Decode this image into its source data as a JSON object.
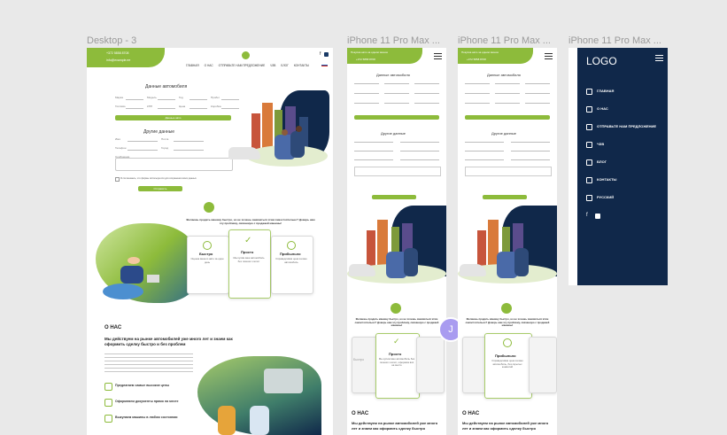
{
  "frames": {
    "desktop": "Desktop - 3",
    "phone1": "iPhone 11 Pro Max ...",
    "phone2": "iPhone 11 Pro Max ...",
    "phone3": "iPhone 11 Pro Max ..."
  },
  "desktop": {
    "phone": "+372 5858 8708",
    "email": "info@example.ee",
    "nav": [
      "ГЛАВНАЯ",
      "О НАС",
      "ОТПРАВЬТЕ НАМ ПРЕДЛОЖЕНИЕ",
      "ЧЗВ",
      "БЛОГ",
      "КОНТАКТЫ"
    ],
    "car_heading": "Данные автомобиля",
    "car_fields": [
      "Марка",
      "Модель",
      "Год",
      "Пробег",
      "Топливо",
      "КПП",
      "Цена",
      "Коробка"
    ],
    "car_btn": "Данные авто",
    "other_heading": "Другие данные",
    "other_fields": [
      "Имя",
      "Почта",
      "Телефон",
      "Город"
    ],
    "comment": "Сообщение",
    "consent": "Я соглашаюсь, что формы используются для сохранения моих данных",
    "submit": "Отправить",
    "question": "Желаешь продать машину быстро, но не хочешь заниматься этим самостоятельно? Доверь нам эту проблему, связанную с продажей машины!",
    "features": [
      {
        "title": "Быстро",
        "text": "Оценка вашего авто за один день"
      },
      {
        "title": "Просто",
        "text": "Мы купим ваш автомобиль без лишних хлопот"
      },
      {
        "title": "Прибыльно",
        "text": "Справедливая цена за ваш автомобиль"
      }
    ],
    "about_title": "О НАС",
    "about_lead": "Мы действуем на рынке автомобилей уже много лет и знаем как оформить сделку быстро и без проблем",
    "bullets": [
      "Предлагаем самые высокие цены",
      "Оформляем документы прямо на месте",
      "Выкупаем машины в любом состоянии"
    ]
  },
  "phone": {
    "banner": "Покупка авто за одним звонок",
    "phone": "+372 5858 8708",
    "car_heading": "Данные автомобиля",
    "other_heading": "Другие данные",
    "question": "Желаешь продать машину быстро, но не хочешь заниматься этим самостоятельно? Доверь нам эту проблему, связанную с продажей машины!",
    "card_simple": {
      "title": "Просто",
      "text": "Мы купим ваш автомобиль без лишних хлопот, оформим всё на месте"
    },
    "card_profit": {
      "title": "Прибыльно",
      "text": "Справедливая цена за ваш автомобиль, без скрытых комиссий"
    },
    "side_left": "Быстро",
    "about_title": "О НАС",
    "about_lead": "Мы действуем на рынке автомобилей уже много лет и знаем как оформить сделку быстро"
  },
  "menu": {
    "logo": "LOGO",
    "items": [
      {
        "label": "ГЛАВНАЯ",
        "icon": "home-icon"
      },
      {
        "label": "О НАС",
        "icon": "people-icon"
      },
      {
        "label": "ОТПРАВЬТЕ НАМ ПРЕДЛОЖЕНИЕ",
        "icon": "mail-icon"
      },
      {
        "label": "ЧЗВ",
        "icon": "chat-icon"
      },
      {
        "label": "БЛОГ",
        "icon": "blog-icon"
      },
      {
        "label": "КОНТАКТЫ",
        "icon": "pin-icon"
      },
      {
        "label": "РУССКИЙ",
        "icon": "flag-icon"
      }
    ]
  },
  "avatar": "J",
  "colors": {
    "green": "#8dbb3b",
    "navy": "#10284a",
    "avatar": "#a99cf0"
  }
}
